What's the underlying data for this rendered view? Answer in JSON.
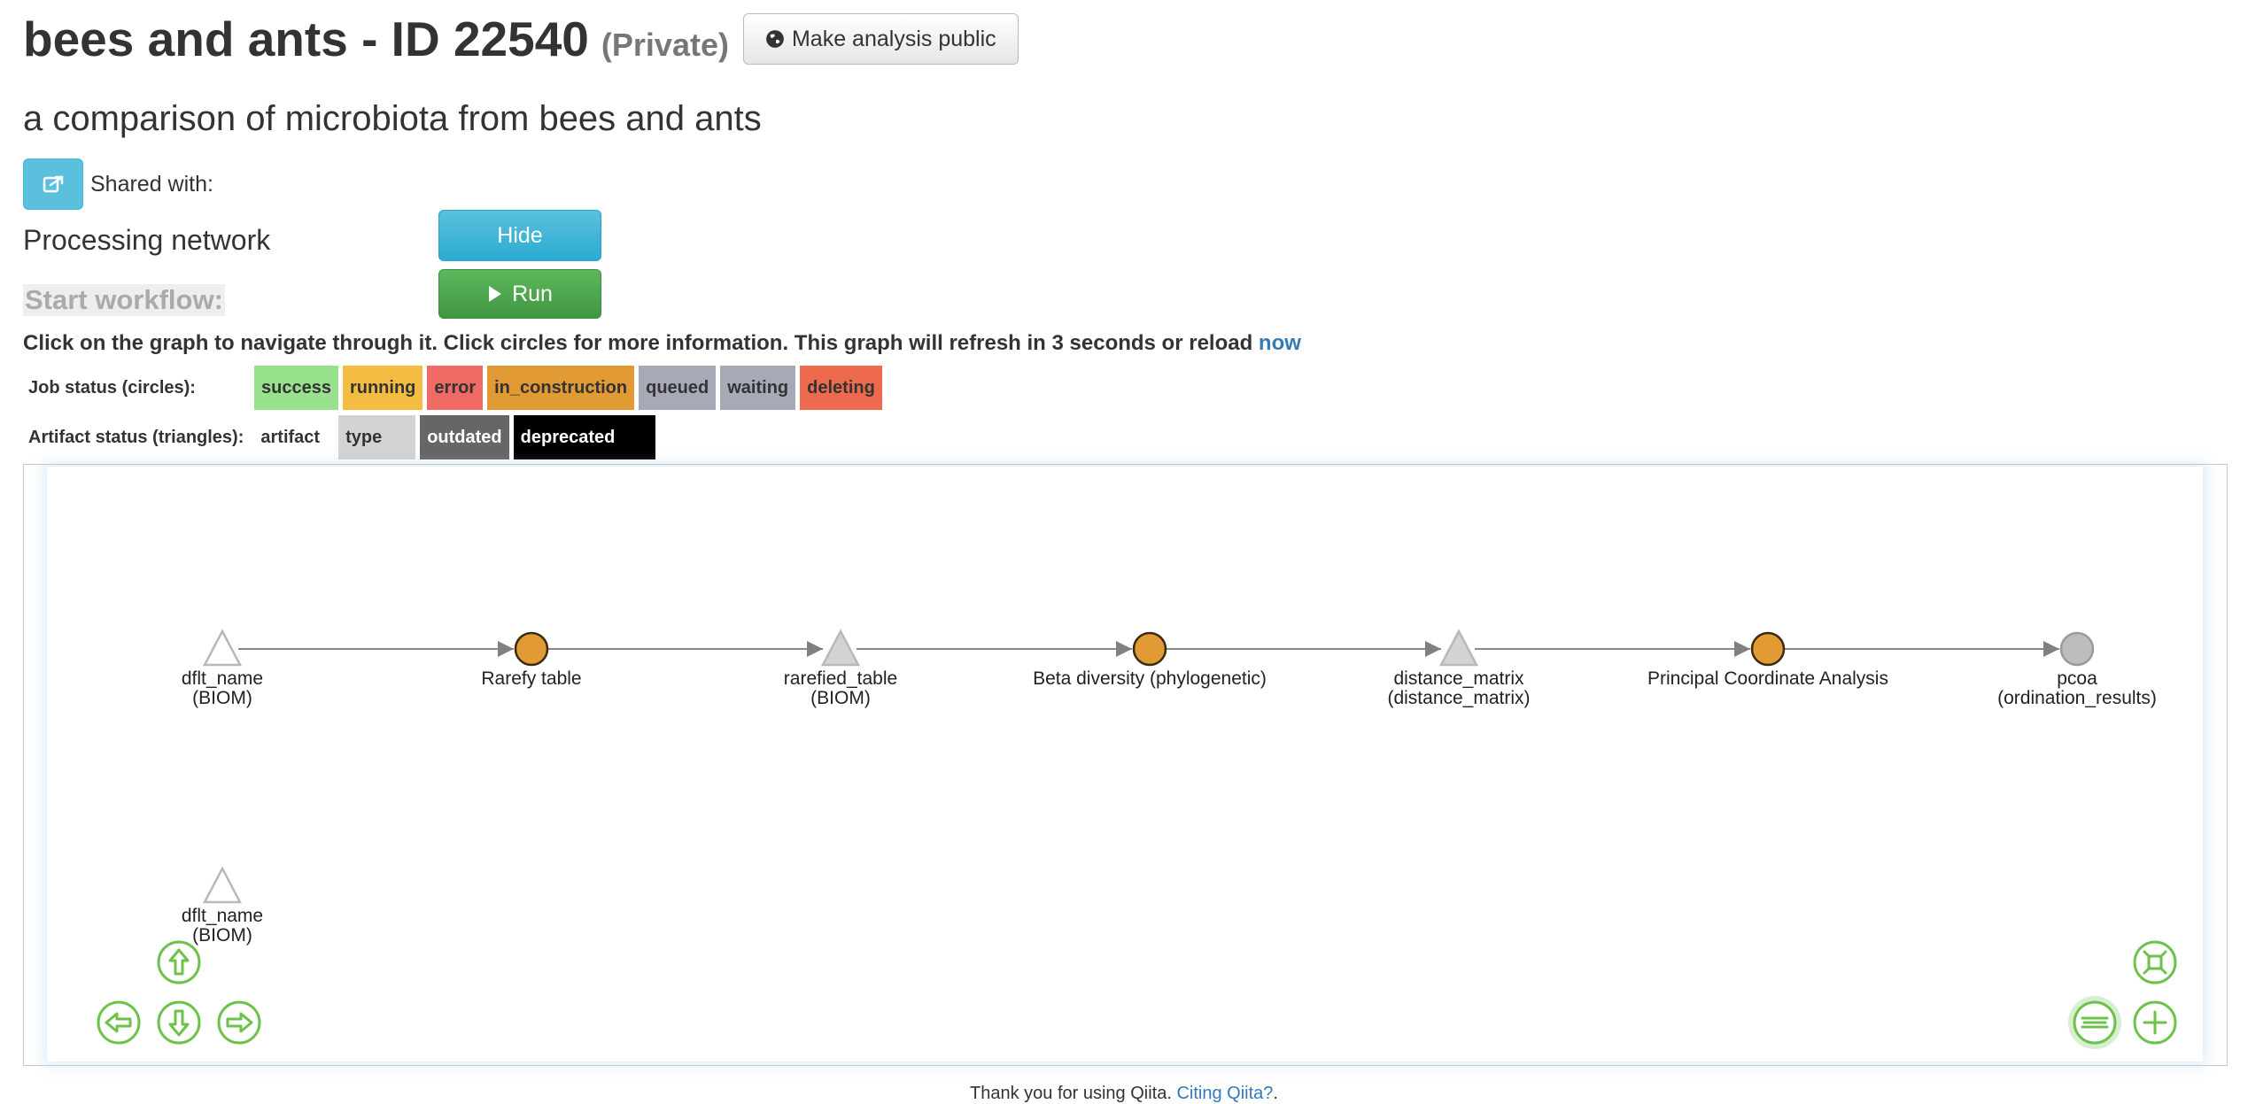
{
  "header": {
    "title": "bees and ants - ID 22540",
    "privacy": "(Private)",
    "make_public_label": "Make analysis public",
    "make_public_icon": "globe-icon"
  },
  "subtitle": "a comparison of microbiota from bees and ants",
  "share": {
    "icon": "share-icon",
    "label": "Shared with:"
  },
  "processing": {
    "title": "Processing network",
    "hide_label": "Hide",
    "start_workflow_label": "Start workflow:",
    "run_label": "Run",
    "run_icon": "play-icon"
  },
  "instructions": {
    "text": "Click on the graph to navigate through it. Click circles for more information. This graph will refresh in 3 seconds or reload ",
    "link": "now"
  },
  "job_status": {
    "label": "Job status (circles):",
    "items": [
      {
        "text": "success",
        "color": "#98e28d"
      },
      {
        "text": "running",
        "color": "#f5bc42"
      },
      {
        "text": "error",
        "color": "#f06a66"
      },
      {
        "text": "in_construction",
        "color": "#e19a34"
      },
      {
        "text": "queued",
        "color": "#a7aab6"
      },
      {
        "text": "waiting",
        "color": "#a7aab6"
      },
      {
        "text": "deleting",
        "color": "#ee6a4f"
      }
    ]
  },
  "artifact_status": {
    "label": "Artifact status (triangles):",
    "items": [
      {
        "text": "artifact",
        "color": "#ffffff"
      },
      {
        "text": "type",
        "color": "#d3d3d3"
      },
      {
        "text": "outdated",
        "color": "#666666"
      },
      {
        "text": "deprecated",
        "color": "#000000"
      }
    ]
  },
  "graph": {
    "nodes": [
      {
        "shape": "triangle",
        "name": "dflt_name",
        "type": "(BIOM)",
        "fill": "#ffffff"
      },
      {
        "shape": "circle",
        "name": "Rarefy table",
        "fill": "#e19a34"
      },
      {
        "shape": "triangle",
        "name": "rarefied_table",
        "type": "(BIOM)",
        "fill": "#d3d3d3"
      },
      {
        "shape": "circle",
        "name": "Beta diversity (phylogenetic)",
        "fill": "#e19a34"
      },
      {
        "shape": "triangle",
        "name": "distance_matrix",
        "type": "(distance_matrix)",
        "fill": "#d3d3d3"
      },
      {
        "shape": "circle",
        "name": "Principal Coordinate Analysis",
        "fill": "#e19a34"
      },
      {
        "shape": "circle",
        "name": "pcoa",
        "type": "(ordination_results)",
        "fill": "#bdbdbd"
      },
      {
        "shape": "triangle",
        "name": "dflt_name",
        "type": "(BIOM)",
        "fill": "#ffffff"
      }
    ],
    "edges": [
      [
        0,
        1
      ],
      [
        1,
        2
      ],
      [
        2,
        3
      ],
      [
        3,
        4
      ],
      [
        4,
        5
      ],
      [
        5,
        6
      ]
    ],
    "nav_color": "#6cc24a"
  },
  "footer": {
    "text": "Thank you for using Qiita. ",
    "link": "Citing Qiita?",
    "suffix": "."
  }
}
